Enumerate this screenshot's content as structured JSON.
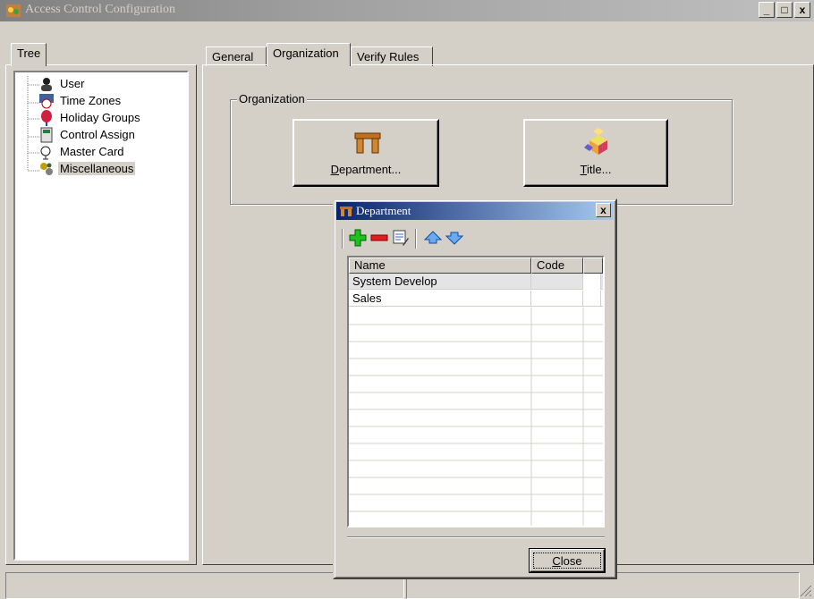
{
  "window": {
    "title": "Access Control Configuration",
    "minimize_label": "_",
    "maximize_label": "□",
    "close_label": "x"
  },
  "left_tabs": [
    {
      "label": "Tree"
    }
  ],
  "tree": {
    "items": [
      {
        "label": "User",
        "icon": "user-icon"
      },
      {
        "label": "Time Zones",
        "icon": "time-zones-icon"
      },
      {
        "label": "Holiday Groups",
        "icon": "holiday-groups-icon"
      },
      {
        "label": "Control Assign",
        "icon": "control-assign-icon"
      },
      {
        "label": "Master Card",
        "icon": "master-card-icon"
      },
      {
        "label": "Miscellaneous",
        "icon": "miscellaneous-icon",
        "selected": true
      }
    ]
  },
  "main_tabs": [
    {
      "label": "General"
    },
    {
      "label": "Organization",
      "active": true
    },
    {
      "label": "Verify Rules"
    }
  ],
  "organization": {
    "group_label": "Organization",
    "department_button": {
      "prefix": "",
      "mnemonic": "D",
      "rest": "epartment...",
      "icon": "desk-icon"
    },
    "title_button": {
      "prefix": "",
      "mnemonic": "T",
      "rest": "itle...",
      "icon": "blocks-icon"
    }
  },
  "dialog": {
    "title": "Department",
    "close_x": "x",
    "toolbar": [
      "add-icon",
      "remove-icon",
      "edit-icon",
      "move-up-icon",
      "move-down-icon"
    ],
    "columns": [
      "Name",
      "Code"
    ],
    "rows": [
      {
        "name": "System Develop",
        "code": ""
      },
      {
        "name": "Sales",
        "code": ""
      }
    ],
    "close_button": {
      "mnemonic": "C",
      "rest": "lose"
    }
  },
  "colors": {
    "face": "#d4d0c8",
    "title_active": "#0a246a",
    "title_inactive": "#808080"
  }
}
